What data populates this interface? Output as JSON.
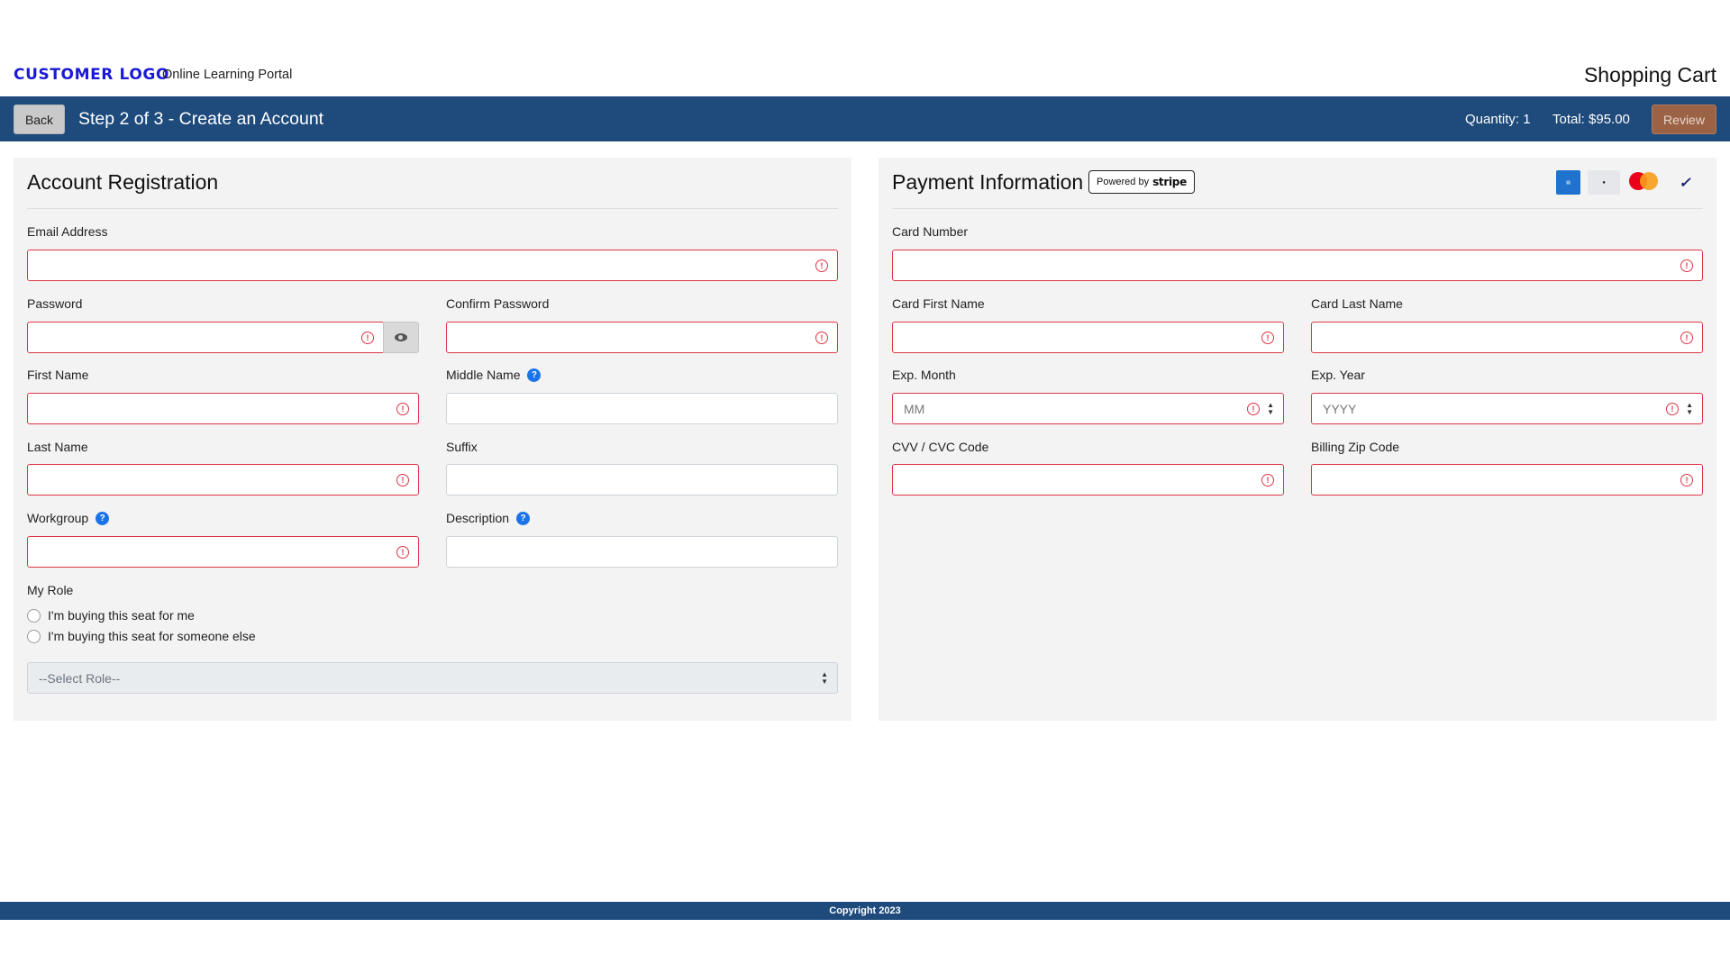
{
  "header": {
    "logo": "CUSTOMER LOGO",
    "portal": "Online Learning Portal",
    "cart_title": "Shopping Cart"
  },
  "stepbar": {
    "back_label": "Back",
    "step_title": "Step 2 of 3 - Create an Account",
    "quantity": "Quantity: 1",
    "total": "Total: $95.00",
    "review_label": "Review"
  },
  "account": {
    "title": "Account Registration",
    "email_label": "Email Address",
    "password_label": "Password",
    "confirm_password_label": "Confirm Password",
    "first_name_label": "First Name",
    "middle_name_label": "Middle Name",
    "last_name_label": "Last Name",
    "suffix_label": "Suffix",
    "workgroup_label": "Workgroup",
    "description_label": "Description",
    "role_label": "My Role",
    "role_options": [
      "I'm buying this seat for me",
      "I'm buying this seat for someone else"
    ],
    "role_select_placeholder": "--Select Role--"
  },
  "payment": {
    "title": "Payment Information",
    "stripe_prefix": "Powered by",
    "stripe_brand": "stripe",
    "card_number_label": "Card Number",
    "card_first_name_label": "Card First Name",
    "card_last_name_label": "Card Last Name",
    "exp_month_label": "Exp. Month",
    "exp_month_placeholder": "MM",
    "exp_year_label": "Exp. Year",
    "exp_year_placeholder": "YYYY",
    "cvv_label": "CVV / CVC Code",
    "zip_label": "Billing Zip Code",
    "card_brands": [
      "american-express",
      "discover",
      "mastercard",
      "visa"
    ]
  },
  "footer": {
    "copyright": "Copyright 2023"
  },
  "icons": {
    "error": "exclamation-circle-icon",
    "help": "question-circle-icon",
    "eye": "eye-icon",
    "select": "sort-arrows-icon"
  },
  "colors": {
    "brand_bar": "#1e4a7c",
    "logo": "#1a1ad6",
    "invalid": "#dc3545",
    "review_button": "#9c6245",
    "help_icon": "#1a73e8"
  }
}
